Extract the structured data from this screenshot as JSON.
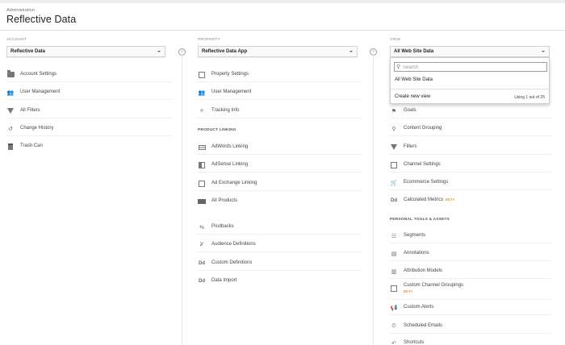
{
  "header": {
    "breadcrumb": "Administration",
    "title": "Reflective Data"
  },
  "account": {
    "heading": "ACCOUNT",
    "selected": "Reflective Data",
    "items": [
      {
        "label": "Account Settings",
        "icon": "building-icon"
      },
      {
        "label": "User Management",
        "icon": "people-icon"
      },
      {
        "label": "All Filters",
        "icon": "filter-icon"
      },
      {
        "label": "Change History",
        "icon": "history-icon"
      },
      {
        "label": "Trash Can",
        "icon": "trash-icon"
      }
    ]
  },
  "property": {
    "heading": "PROPERTY",
    "selected": "Reflective Data App",
    "items": [
      {
        "label": "Property Settings",
        "icon": "settings-box-icon"
      },
      {
        "label": "User Management",
        "icon": "people-icon"
      },
      {
        "label": "Tracking Info",
        "icon": "code-icon"
      }
    ],
    "linking_heading": "PRODUCT LINKING",
    "linking_items": [
      {
        "label": "AdWords Linking",
        "icon": "adwords-icon"
      },
      {
        "label": "AdSense Linking",
        "icon": "adsense-icon"
      },
      {
        "label": "Ad Exchange Linking",
        "icon": "adexchange-icon"
      },
      {
        "label": "All Products",
        "icon": "products-icon"
      }
    ],
    "other_items": [
      {
        "label": "Postbacks",
        "icon": "postback-icon"
      },
      {
        "label": "Audience Definitions",
        "icon": "audience-icon"
      },
      {
        "label": "Custom Definitions",
        "icon": "dd-icon",
        "glyph": "Dd"
      },
      {
        "label": "Data Import",
        "icon": "dd-icon",
        "glyph": "Dd"
      }
    ]
  },
  "view": {
    "heading": "VIEW",
    "selected": "All Web Site Data",
    "dropdown": {
      "search_placeholder": "Search",
      "option": "All Web Site Data",
      "create_label": "Create new view",
      "count_label": "Using 1 out of 25"
    },
    "items": [
      {
        "label": "Goals",
        "icon": "flag-icon"
      },
      {
        "label": "Content Grouping",
        "icon": "grouping-icon"
      },
      {
        "label": "Filters",
        "icon": "filter-icon"
      },
      {
        "label": "Channel Settings",
        "icon": "channel-icon"
      },
      {
        "label": "Ecommerce Settings",
        "icon": "cart-icon"
      },
      {
        "label": "Calculated Metrics",
        "icon": "dd-icon",
        "glyph": "Dd",
        "beta": "BETA"
      }
    ],
    "tools_heading": "PERSONAL TOOLS & ASSETS",
    "tools": [
      {
        "label": "Segments",
        "icon": "segments-icon"
      },
      {
        "label": "Annotations",
        "icon": "annotation-icon"
      },
      {
        "label": "Attribution Models",
        "icon": "bar-chart-icon"
      },
      {
        "label": "Custom Channel Groupings",
        "icon": "channel-group-icon",
        "beta": "BETA"
      },
      {
        "label": "Custom Alerts",
        "icon": "megaphone-icon"
      },
      {
        "label": "Scheduled Emails",
        "icon": "clock-icon"
      },
      {
        "label": "Shortcuts",
        "icon": "shortcut-icon"
      }
    ]
  },
  "colors": {
    "accent_beta": "#e37400",
    "divider": "#e6e6e6"
  }
}
